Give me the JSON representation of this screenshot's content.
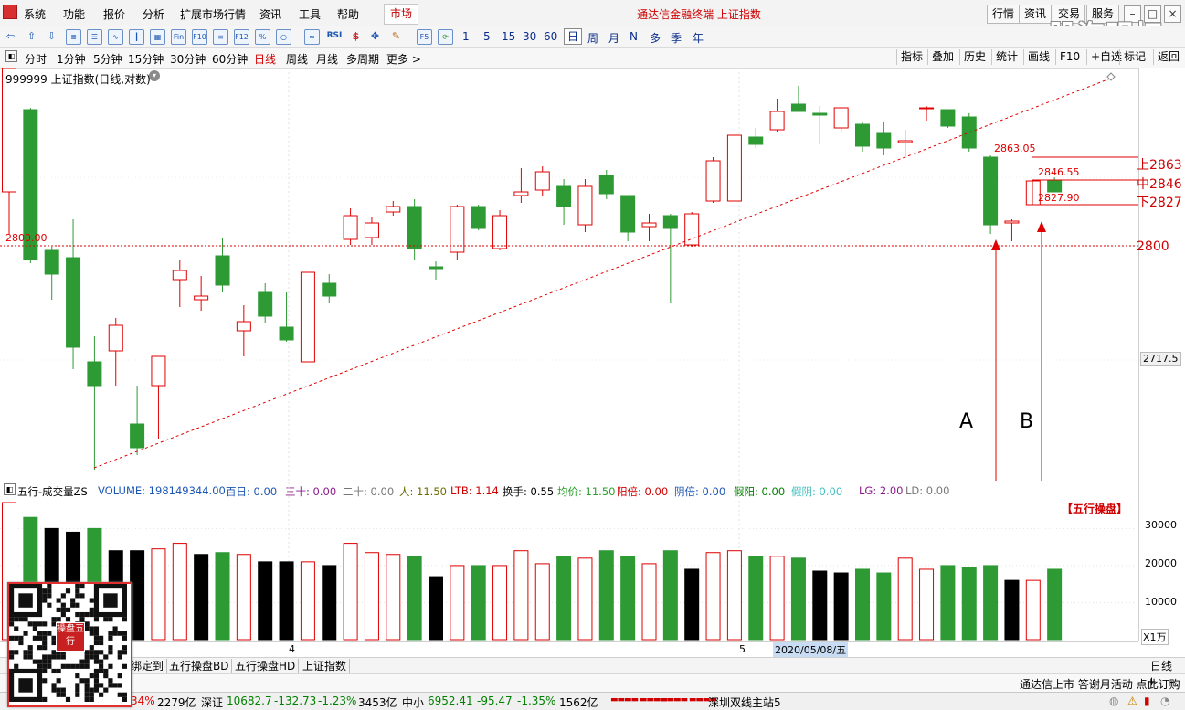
{
  "menu": {
    "items": [
      "系统",
      "功能",
      "报价",
      "分析",
      "扩展市场行情",
      "资讯",
      "工具",
      "帮助"
    ],
    "market_tab": "市场",
    "title": "通达信金融终端 上证指数",
    "right_buttons": [
      "行情",
      "资讯",
      "交易",
      "服务"
    ],
    "watermark": "股海明灯"
  },
  "toolbar": {
    "periods": [
      "1",
      "5",
      "15",
      "30",
      "60"
    ],
    "period_words": [
      "日",
      "周",
      "月",
      "N",
      "多",
      "季",
      "年"
    ],
    "rsi_label": "RSI",
    "box_labels": [
      "Fin",
      "F10",
      "F12",
      "F5"
    ]
  },
  "periodbar": {
    "items": [
      "分时",
      "1分钟",
      "5分钟",
      "15分钟",
      "30分钟",
      "60分钟",
      "日线",
      "周线",
      "月线",
      "多周期",
      "更多 >"
    ],
    "active": "日线",
    "right_buttons": [
      "指标",
      "叠加",
      "历史",
      "统计",
      "画线",
      "F10",
      "+自选",
      "标记",
      "返回"
    ]
  },
  "chart": {
    "label": "999999 上证指数(日线,对数)",
    "left_level_label": "2800.00",
    "high_label": "2863.05",
    "mid_label": "2846.55",
    "low_label": "2827.90",
    "axis_upper": "上2863",
    "axis_mid": "中2846",
    "axis_lower": "下2827",
    "axis_level": "2800",
    "axis_current": "2717.5",
    "annotation_a": "A",
    "annotation_b": "B",
    "vol_right_labels": [
      "30000",
      "20000",
      "10000"
    ],
    "vol_unit": "X1万",
    "wuxing_label": "【五行操盘】"
  },
  "chart_data": [
    {
      "type": "candlestick",
      "title": "999999 上证指数(日线,对数)",
      "levels": {
        "upper": 2863,
        "mid": 2846,
        "lower": 2827,
        "support": 2800,
        "current": 2717.5
      },
      "candles": [
        {
          "o": 0,
          "h": 10,
          "l": 182,
          "c": 136,
          "color": "red"
        },
        {
          "o": 210,
          "h": 44,
          "l": 214,
          "c": 46,
          "color": "green"
        },
        {
          "o": 226,
          "h": 196,
          "l": 254,
          "c": 200,
          "color": "green"
        },
        {
          "o": 306,
          "h": 166,
          "l": 330,
          "c": 208,
          "color": "green"
        },
        {
          "o": 348,
          "h": 294,
          "l": 440,
          "c": 322,
          "color": "green"
        },
        {
          "o": 310,
          "h": 274,
          "l": 348,
          "c": 282,
          "color": "red"
        },
        {
          "o": 416,
          "h": 348,
          "l": 424,
          "c": 390,
          "color": "green"
        },
        {
          "o": 348,
          "h": 316,
          "l": 406,
          "c": 316,
          "color": "red"
        },
        {
          "o": 232,
          "h": 210,
          "l": 262,
          "c": 222,
          "color": "red"
        },
        {
          "o": 254,
          "h": 228,
          "l": 266,
          "c": 250,
          "color": "red"
        },
        {
          "o": 238,
          "h": 186,
          "l": 246,
          "c": 206,
          "color": "green"
        },
        {
          "o": 288,
          "h": 260,
          "l": 316,
          "c": 278,
          "color": "red"
        },
        {
          "o": 272,
          "h": 236,
          "l": 280,
          "c": 246,
          "color": "green"
        },
        {
          "o": 298,
          "h": 246,
          "l": 300,
          "c": 284,
          "color": "green"
        },
        {
          "o": 322,
          "h": 224,
          "l": 322,
          "c": 224,
          "color": "red"
        },
        {
          "o": 250,
          "h": 226,
          "l": 258,
          "c": 236,
          "color": "green"
        },
        {
          "o": 188,
          "h": 154,
          "l": 194,
          "c": 162,
          "color": "red"
        },
        {
          "o": 186,
          "h": 164,
          "l": 194,
          "c": 170,
          "color": "red"
        },
        {
          "o": 158,
          "h": 146,
          "l": 162,
          "c": 152,
          "color": "red"
        },
        {
          "o": 152,
          "h": 144,
          "l": 210,
          "c": 198,
          "color": "green"
        },
        {
          "o": 218,
          "h": 212,
          "l": 232,
          "c": 220,
          "color": "green"
        },
        {
          "o": 202,
          "h": 150,
          "l": 210,
          "c": 152,
          "color": "red"
        },
        {
          "o": 152,
          "h": 150,
          "l": 178,
          "c": 176,
          "color": "green"
        },
        {
          "o": 198,
          "h": 156,
          "l": 200,
          "c": 162,
          "color": "red"
        },
        {
          "o": 140,
          "h": 110,
          "l": 148,
          "c": 136,
          "color": "red"
        },
        {
          "o": 114,
          "h": 108,
          "l": 140,
          "c": 134,
          "color": "red"
        },
        {
          "o": 130,
          "h": 122,
          "l": 172,
          "c": 152,
          "color": "green"
        },
        {
          "o": 172,
          "h": 122,
          "l": 180,
          "c": 130,
          "color": "red"
        },
        {
          "o": 118,
          "h": 112,
          "l": 144,
          "c": 138,
          "color": "green"
        },
        {
          "o": 140,
          "h": 150,
          "l": 190,
          "c": 180,
          "color": "green"
        },
        {
          "o": 174,
          "h": 160,
          "l": 190,
          "c": 170,
          "color": "red"
        },
        {
          "o": 162,
          "h": 160,
          "l": 258,
          "c": 176,
          "color": "green"
        },
        {
          "o": 194,
          "h": 158,
          "l": 196,
          "c": 160,
          "color": "red"
        },
        {
          "o": 146,
          "h": 98,
          "l": 148,
          "c": 102,
          "color": "red"
        },
        {
          "o": 146,
          "h": 74,
          "l": 146,
          "c": 74,
          "color": "red"
        },
        {
          "o": 76,
          "h": 66,
          "l": 88,
          "c": 84,
          "color": "green"
        },
        {
          "o": 68,
          "h": 34,
          "l": 70,
          "c": 48,
          "color": "red"
        },
        {
          "o": 40,
          "h": 20,
          "l": 48,
          "c": 48,
          "color": "green"
        },
        {
          "o": 50,
          "h": 42,
          "l": 84,
          "c": 52,
          "color": "green"
        },
        {
          "o": 66,
          "h": 44,
          "l": 70,
          "c": 44,
          "color": "red"
        },
        {
          "o": 62,
          "h": 60,
          "l": 92,
          "c": 86,
          "color": "green"
        },
        {
          "o": 72,
          "h": 60,
          "l": 96,
          "c": 88,
          "color": "green"
        },
        {
          "o": 82,
          "h": 68,
          "l": 98,
          "c": 80,
          "color": "red"
        },
        {
          "o": 44,
          "h": 42,
          "l": 58,
          "c": 44,
          "color": "red"
        },
        {
          "o": 46,
          "h": 48,
          "l": 66,
          "c": 64,
          "color": "green"
        },
        {
          "o": 54,
          "h": 50,
          "l": 92,
          "c": 88,
          "color": "green"
        },
        {
          "o": 98,
          "h": 96,
          "l": 182,
          "c": 172,
          "color": "green"
        },
        {
          "o": 170,
          "h": 166,
          "l": 190,
          "c": 168,
          "color": "red"
        },
        {
          "o": 150,
          "h": 124,
          "l": 150,
          "c": 124,
          "color": "red"
        },
        {
          "o": 124,
          "h": 120,
          "l": 136,
          "c": 136,
          "color": "green"
        }
      ],
      "volume": {
        "series": [
          37000,
          33000,
          30000,
          29000,
          30000,
          24000,
          24000,
          24500,
          26000,
          23000,
          23500,
          23000,
          21000,
          21000,
          21000,
          20000,
          26000,
          23500,
          23000,
          22500,
          17000,
          20000,
          20000,
          20000,
          24000,
          20500,
          22500,
          22000,
          24000,
          22500,
          20500,
          24000,
          19000,
          23500,
          24000,
          22500,
          22500,
          22000,
          18500,
          18000,
          19000,
          18000,
          22000,
          19000,
          20000,
          19500,
          20000,
          16000,
          16000,
          19000
        ],
        "colors": [
          "red",
          "green",
          "black",
          "black",
          "green",
          "black",
          "black",
          "red",
          "red",
          "black",
          "green",
          "red",
          "black",
          "black",
          "red",
          "black",
          "red",
          "red",
          "red",
          "green",
          "black",
          "red",
          "green",
          "red",
          "red",
          "red",
          "green",
          "red",
          "green",
          "green",
          "red",
          "green",
          "black",
          "red",
          "red",
          "green",
          "red",
          "green",
          "black",
          "black",
          "green",
          "green",
          "red",
          "red",
          "green",
          "green",
          "green",
          "black",
          "red",
          "green"
        ]
      },
      "x_ticks": [
        "4",
        "5",
        "2020/05/08/五"
      ]
    }
  ],
  "vol_header": {
    "name": "五行-成交量ZS",
    "volume": "VOLUME: 198149344.00",
    "bairi": "百日: 0.00",
    "sanshi": "三十: 0.00",
    "ershi": "二十: 0.00",
    "ren": "人: 11.50",
    "ltb": "LTB: 1.14",
    "huanshou": "换手: 0.55",
    "junjia": "均价: 11.50",
    "yangbei": "阳倍: 0.00",
    "yinbei": "阴倍: 0.00",
    "jiayang": "假阳: 0.00",
    "jiayin": "假阴: 0.00",
    "lg": "LG: 2.00",
    "ld": "LD: 0.00"
  },
  "tabs": [
    "绑定到",
    "五行操盘BD",
    "五行操盘HD",
    "上证指数"
  ],
  "right_tab": "日线",
  "scroll": {
    "plus": "+",
    "minus": "-",
    "notice": "通达信上市 答谢月活动 点此订购"
  },
  "status": {
    "shanghai_pct": "34%",
    "shanghai_amt": "2279亿",
    "shenzhen_label": "深证",
    "shenzhen_val": "10682.7",
    "shenzhen_chg": "-132.73",
    "shenzhen_pct": "-1.23%",
    "shenzhen_amt": "3453亿",
    "zhongxiao_label": "中小",
    "zhongxiao_val": "6952.41",
    "zhongxiao_chg": "-95.47",
    "zhongxiao_pct": "-1.35%",
    "zhongxiao_amt": "1562亿",
    "server": "深圳双线主站5"
  },
  "qr_seal": "操盘五行"
}
